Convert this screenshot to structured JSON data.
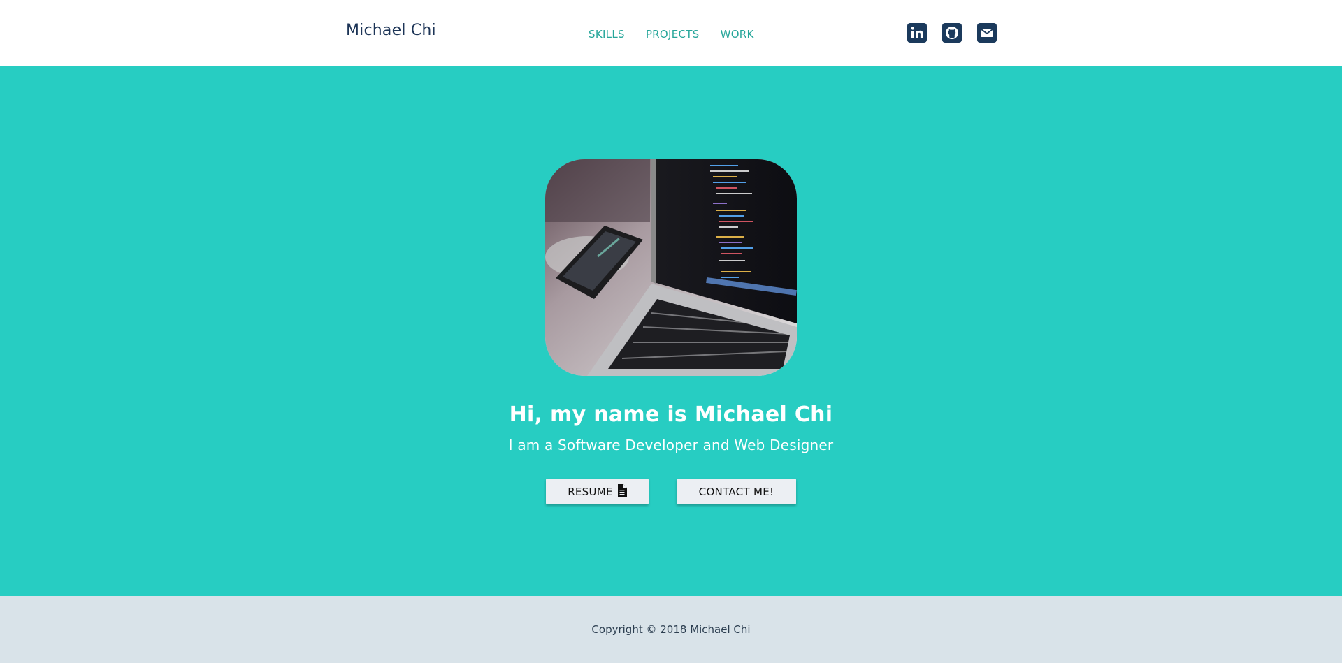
{
  "header": {
    "brand": "Michael Chi",
    "nav": [
      {
        "label": "SKILLS"
      },
      {
        "label": "PROJECTS"
      },
      {
        "label": "WORK"
      }
    ],
    "socials": [
      {
        "icon": "linkedin-icon"
      },
      {
        "icon": "github-icon"
      },
      {
        "icon": "email-icon"
      }
    ]
  },
  "hero": {
    "photo_icon": "laptop-code-photo",
    "greeting": "Hi, my name is Michael Chi",
    "tagline": "I am a Software Developer and Web Designer",
    "resume_label": "RESUME",
    "resume_icon": "file-icon",
    "contact_label": "CONTACT ME!"
  },
  "footer": {
    "copyright": "Copyright © 2018 Michael Chi"
  },
  "colors": {
    "hero_bg": "#27cdc2",
    "nav_link": "#26a69a",
    "brand_text": "#1d3557",
    "social_icon_bg": "#1b3a5c",
    "footer_bg": "#d9e3e9",
    "button_bg": "#eceff3"
  }
}
